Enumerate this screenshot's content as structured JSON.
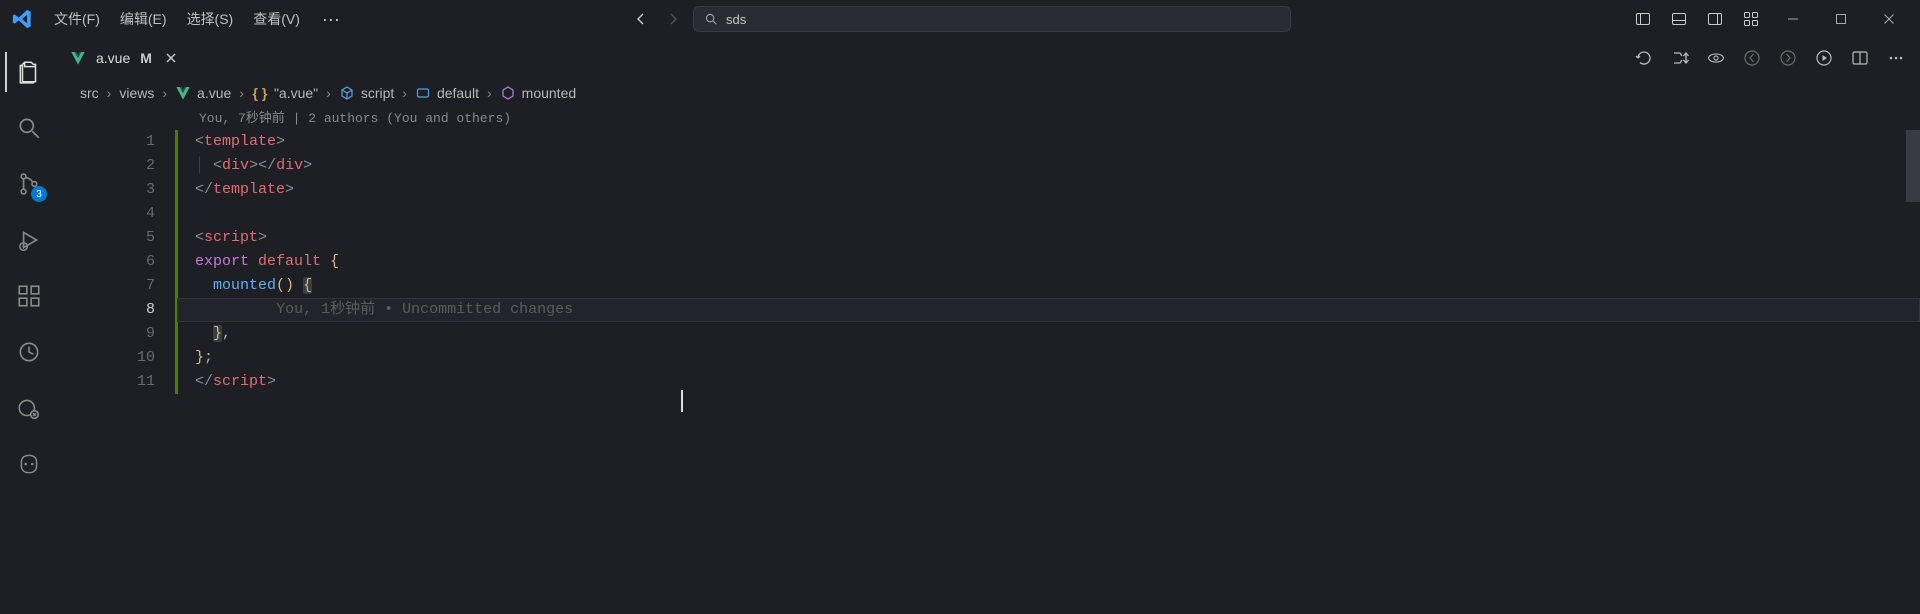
{
  "menu": {
    "file": "文件(F)",
    "edit": "编辑(E)",
    "select": "选择(S)",
    "view": "查看(V)",
    "more": "···"
  },
  "search": {
    "text": "sds"
  },
  "activity": {
    "scm_badge": "3"
  },
  "tab": {
    "filename": "a.vue",
    "modified": "M"
  },
  "breadcrumbs": {
    "src": "src",
    "views": "views",
    "file": "a.vue",
    "section": "\"a.vue\"",
    "script": "script",
    "default": "default",
    "mounted": "mounted"
  },
  "blame_top": "You, 7秒钟前 | 2 authors (You and others)",
  "code": {
    "l1_tag": "template",
    "l2_tag": "div",
    "l3_tag": "template",
    "l5_tag": "script",
    "l6_export": "export",
    "l6_default": "default",
    "l7_mounted": "mounted",
    "l11_tag": "script",
    "ghost": "You, 1秒钟前 • Uncommitted changes"
  },
  "lines": [
    "1",
    "2",
    "3",
    "4",
    "5",
    "6",
    "7",
    "8",
    "9",
    "10",
    "11"
  ]
}
